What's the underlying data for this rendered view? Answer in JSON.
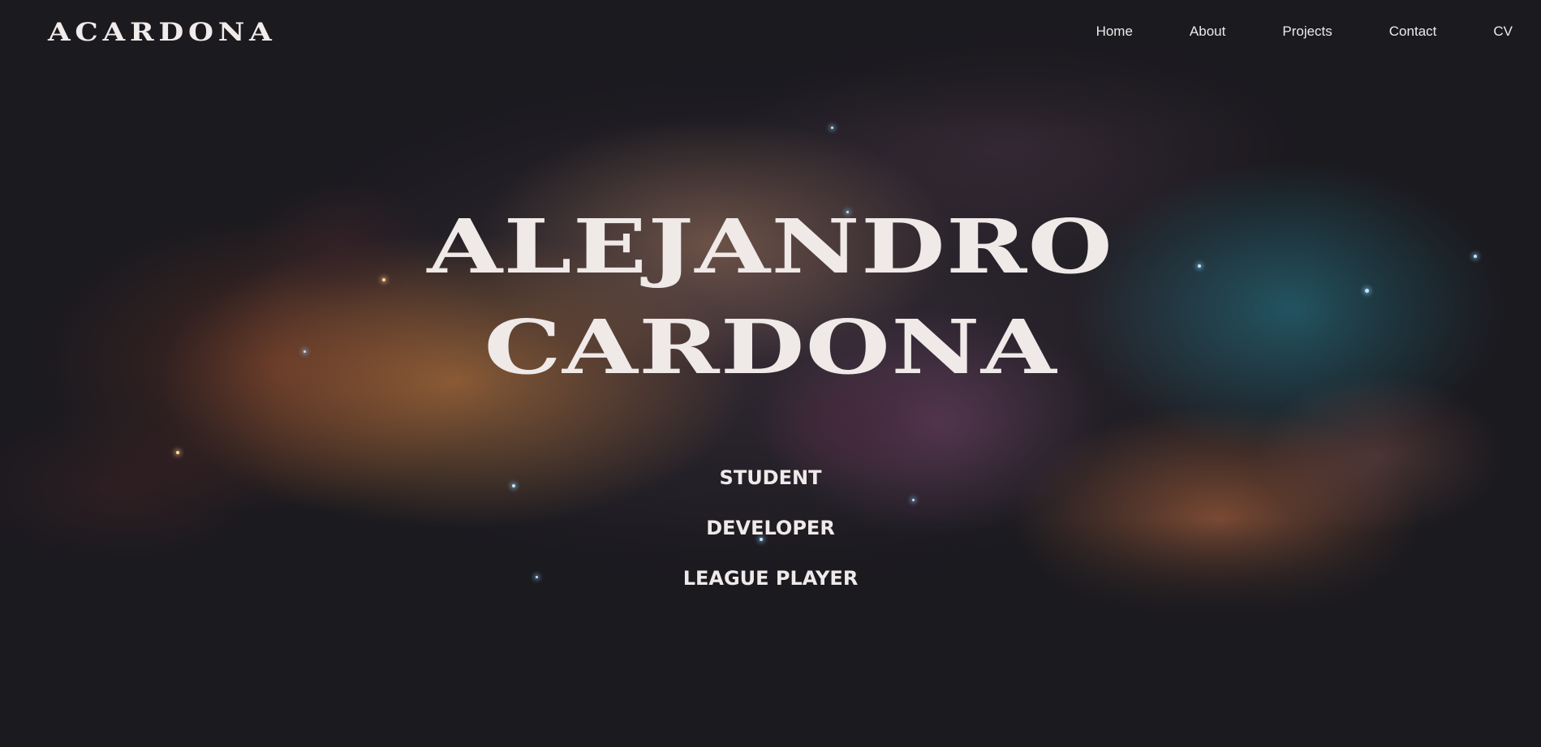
{
  "header": {
    "logo": "ACARDONA",
    "nav": [
      {
        "label": "Home"
      },
      {
        "label": "About"
      },
      {
        "label": "Projects"
      },
      {
        "label": "Contact"
      },
      {
        "label": "CV"
      }
    ]
  },
  "hero": {
    "name_line_1": "ALEJANDRO",
    "name_line_2": "CARDONA",
    "roles": [
      "STUDENT",
      "DEVELOPER",
      "LEAGUE PLAYER"
    ]
  },
  "colors": {
    "background": "#1b1a1f",
    "text": "#efeae9"
  }
}
